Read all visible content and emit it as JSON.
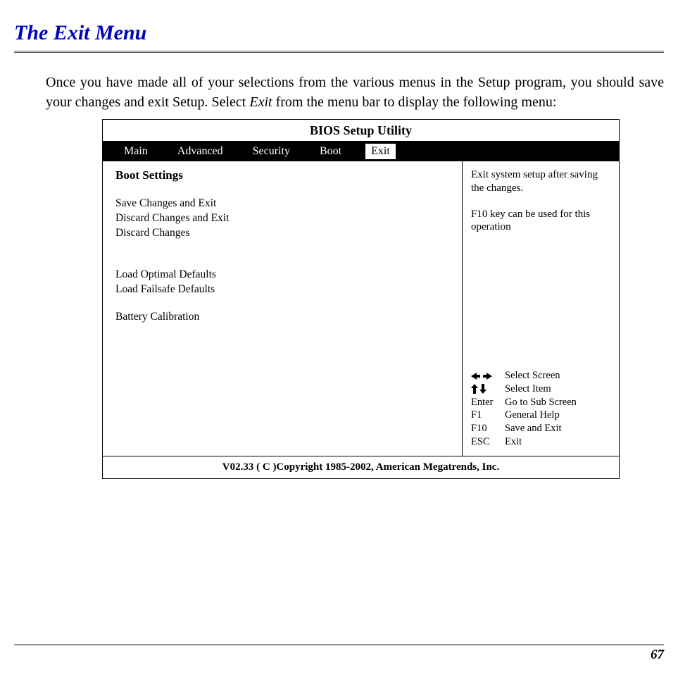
{
  "heading": "The Exit Menu",
  "intro_parts": {
    "p1": "Once you have made all of your selections from the various menus in the Setup program, you should save your changes and exit Setup.  Select ",
    "exit": "Exit",
    "p2": " from the menu bar to display the following menu:"
  },
  "bios": {
    "title": "BIOS Setup Utility",
    "tabs": [
      "Main",
      "Advanced",
      "Security",
      "Boot",
      "Exit"
    ],
    "active_tab_index": 4,
    "panel_title": "Boot Settings",
    "group1": [
      "Save Changes and Exit",
      "Discard Changes and Exit",
      "Discard Changes"
    ],
    "group2": [
      "Load Optimal Defaults",
      "Load Failsafe Defaults"
    ],
    "group3": [
      "Battery Calibration"
    ],
    "help_top": [
      "Exit system setup after saving the changes.",
      "F10 key can be used for this operation"
    ],
    "key_help": [
      {
        "k": "__LR__",
        "d": "Select Screen"
      },
      {
        "k": "__UD__",
        "d": "Select Item"
      },
      {
        "k": "Enter",
        "d": "Go to Sub Screen"
      },
      {
        "k": "F1",
        "d": "General Help"
      },
      {
        "k": "F10",
        "d": "Save and Exit"
      },
      {
        "k": "ESC",
        "d": "Exit"
      }
    ],
    "footer": "V02.33 ( C )Copyright 1985-2002, American Megatrends, Inc."
  },
  "page_number": "67"
}
